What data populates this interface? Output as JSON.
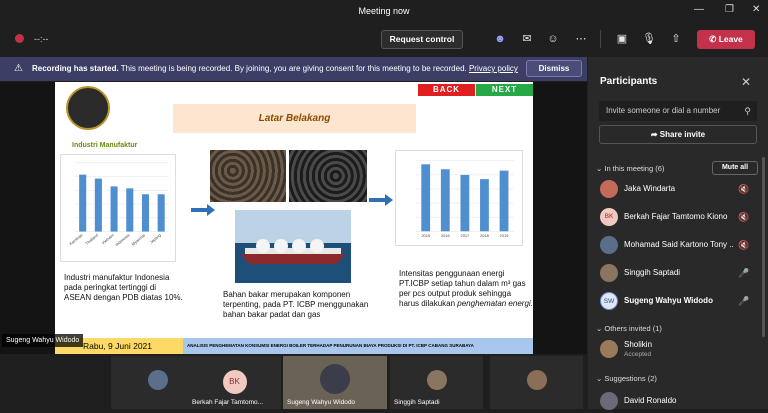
{
  "window": {
    "title": "Meeting now"
  },
  "toolbar": {
    "timer": "--:--",
    "request_control": "Request control",
    "leave": "Leave"
  },
  "banner": {
    "heading": "Recording has started.",
    "text": "This meeting is being recorded. By joining, you are giving consent for this meeting to be recorded.",
    "link": "Privacy policy",
    "dismiss": "Dismiss"
  },
  "slide": {
    "back": "BACK",
    "next": "NEXT",
    "header": "Latar Belakang",
    "chart1_title": "Industri Manufaktur",
    "text1": "Industri manufaktur Indonesia pada peringkat tertinggi di ASEAN dengan PDB diatas 10%.",
    "text2": "Bahan bakar merupakan komponen terpenting, pada PT. ICBP menggunakan bahan bakar padat dan gas",
    "text3_main": "Intensitas penggunaan energi PT.ICBP setiap tahun dalam m³ gas per pcs output produk sehingga harus dilakukan",
    "text3_em": "penghematan energi.",
    "footer_date": "Rabu, 9 Juni 2021",
    "footer_analysis": "ANALISIS PENGHEMATAN KONSUMSI ENERGI BOILER TERHADAP PENURUNAN BIAYA PRODUKSI DI PT. ICBP CABANG SURABAYA"
  },
  "presenter_label": "Sugeng Wahyu Widodo",
  "chart_data": [
    {
      "type": "bar",
      "categories": [
        "Kamboja",
        "Thailand",
        "Vietnam",
        "Indonesia",
        "Myanmar",
        "Jepang"
      ],
      "values": [
        29,
        27,
        23,
        22,
        19,
        19
      ],
      "ylim": [
        0,
        35
      ],
      "color": "#4f8fd0"
    },
    {
      "type": "bar",
      "categories": [
        "2015",
        "2016",
        "2017",
        "2018",
        "2019"
      ],
      "values": [
        0.95,
        0.88,
        0.8,
        0.74,
        0.86
      ],
      "ylim": [
        0,
        1.0
      ],
      "color": "#4f8fd0"
    }
  ],
  "strip": {
    "tiles": [
      {
        "name": "",
        "initials": ""
      },
      {
        "name": "Berkah Fajar Tamtomo...",
        "initials": "BK"
      },
      {
        "name": "Sugeng Wahyu Widodo",
        "initials": ""
      },
      {
        "name": "Singgih Saptadi",
        "initials": ""
      },
      {
        "name": "",
        "initials": ""
      }
    ]
  },
  "panel": {
    "title": "Participants",
    "invite_placeholder": "Invite someone or dial a number",
    "share_invite": "Share invite",
    "in_meeting": "In this meeting (6)",
    "mute_all": "Mute all",
    "participants": [
      {
        "name": "Jaka Windarta",
        "initials": "",
        "mic": "muted"
      },
      {
        "name": "Berkah Fajar Tamtomo Kiono",
        "initials": "BK",
        "mic": "muted"
      },
      {
        "name": "Mohamad Said Kartono Tony ...",
        "initials": "",
        "mic": "muted"
      },
      {
        "name": "Singgih Saptadi",
        "initials": "",
        "mic": "on"
      },
      {
        "name": "Sugeng Wahyu Widodo",
        "initials": "SW",
        "mic": "on"
      }
    ],
    "others_invited": "Others invited (1)",
    "invited": [
      {
        "name": "Sholikin",
        "status": "Accepted"
      }
    ],
    "suggestions": "Suggestions (2)",
    "suggested": [
      {
        "name": "David Ronaldo"
      }
    ]
  }
}
